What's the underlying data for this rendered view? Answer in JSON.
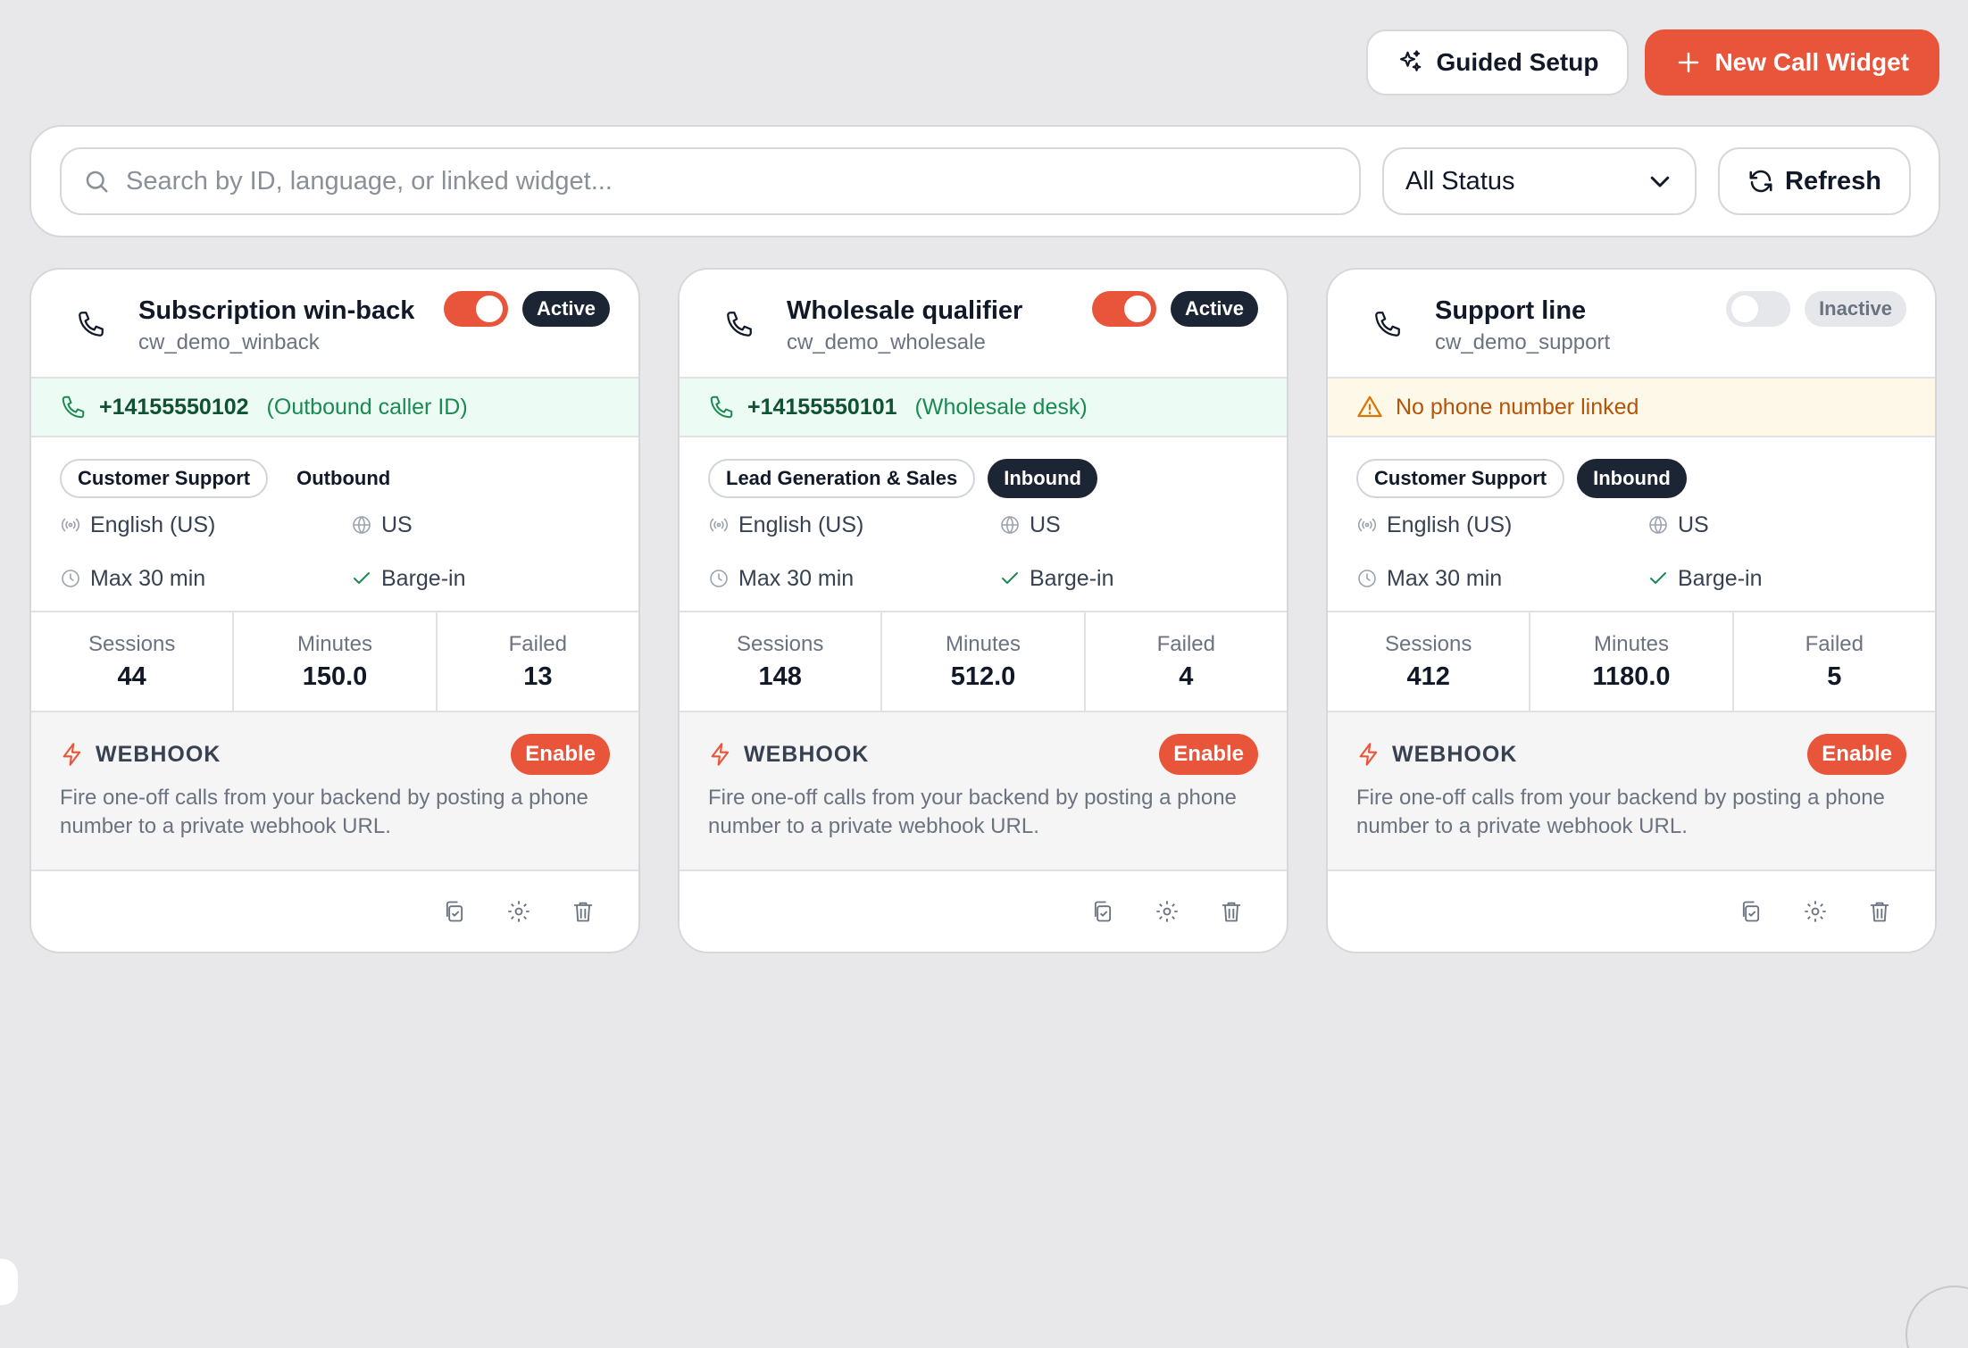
{
  "toolbar": {
    "guided_setup_label": "Guided Setup",
    "new_widget_label": "New Call Widget"
  },
  "filters": {
    "search_placeholder": "Search by ID, language, or linked widget...",
    "status_selected": "All Status",
    "refresh_label": "Refresh"
  },
  "colors": {
    "accent": "#e8553a",
    "dark_badge": "#1c2533",
    "success_bg": "#ecfbf3",
    "warn_bg": "#fef8e8"
  },
  "cards": [
    {
      "title": "Subscription win-back",
      "id": "cw_demo_winback",
      "status": "Active",
      "phone_number": "+14155550102",
      "caller_label": "(Outbound caller ID)",
      "category": "Customer Support",
      "direction": "Outbound",
      "language": "English (US)",
      "region": "US",
      "max_duration": "Max 30 min",
      "feature": "Barge-in",
      "sessions_label": "Sessions",
      "sessions": "44",
      "minutes_label": "Minutes",
      "minutes": "150.0",
      "failed_label": "Failed",
      "failed": "13",
      "webhook_label": "WEBHOOK",
      "enable_label": "Enable",
      "webhook_desc": "Fire one-off calls from your backend by posting a phone number to a private webhook URL."
    },
    {
      "title": "Wholesale qualifier",
      "id": "cw_demo_wholesale",
      "status": "Active",
      "phone_number": "+14155550101",
      "caller_label": "(Wholesale desk)",
      "category": "Lead Generation & Sales",
      "direction": "Inbound",
      "language": "English (US)",
      "region": "US",
      "max_duration": "Max 30 min",
      "feature": "Barge-in",
      "sessions_label": "Sessions",
      "sessions": "148",
      "minutes_label": "Minutes",
      "minutes": "512.0",
      "failed_label": "Failed",
      "failed": "4",
      "webhook_label": "WEBHOOK",
      "enable_label": "Enable",
      "webhook_desc": "Fire one-off calls from your backend by posting a phone number to a private webhook URL."
    },
    {
      "title": "Support line",
      "id": "cw_demo_support",
      "status": "Inactive",
      "no_phone_text": "No phone number linked",
      "category": "Customer Support",
      "direction": "Inbound",
      "language": "English (US)",
      "region": "US",
      "max_duration": "Max 30 min",
      "feature": "Barge-in",
      "sessions_label": "Sessions",
      "sessions": "412",
      "minutes_label": "Minutes",
      "minutes": "1180.0",
      "failed_label": "Failed",
      "failed": "5",
      "webhook_label": "WEBHOOK",
      "enable_label": "Enable",
      "webhook_desc": "Fire one-off calls from your backend by posting a phone number to a private webhook URL."
    }
  ]
}
